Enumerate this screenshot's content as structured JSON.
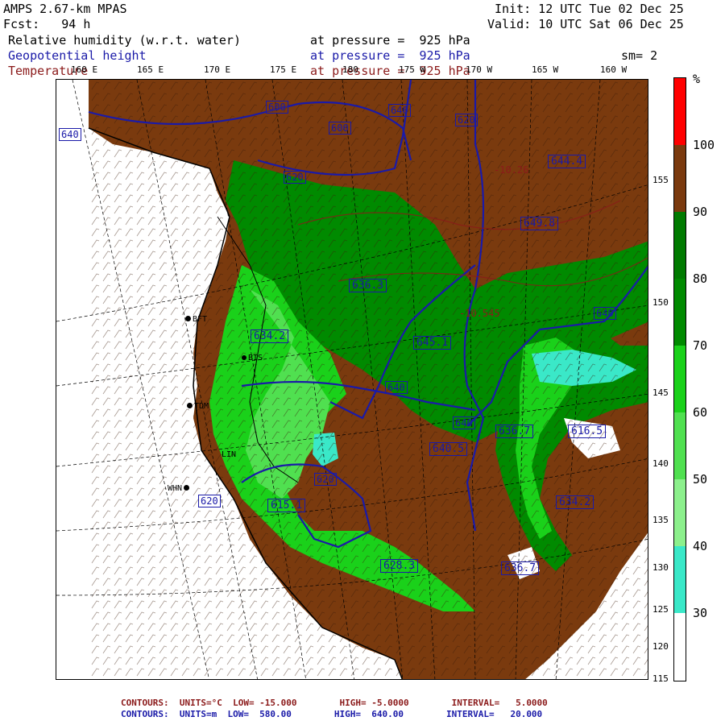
{
  "header": {
    "model": "AMPS 2.67-km MPAS",
    "init": "Init: 12 UTC Tue 02 Dec 25",
    "forecast": "Fcst:   94 h",
    "valid": "Valid: 10 UTC Sat 06 Dec 25",
    "field1": "Relative humidity (w.r.t. water)",
    "field1_level": "at pressure =  925 hPa",
    "field2": "Geopotential height",
    "field2_level": "at pressure =  925 hPa",
    "field3": "Temperature",
    "field3_level": "at pressure =  925 hPa",
    "smooth": "sm= 2"
  },
  "lon_labels": [
    "160 E",
    "165 E",
    "170 E",
    "175 E",
    "180",
    "175 W",
    "170 W",
    "165 W",
    "160 W"
  ],
  "lat_labels": [
    "155",
    "150",
    "145",
    "140",
    "135",
    "130",
    "125",
    "120",
    "115"
  ],
  "colorbar": {
    "unit": "%",
    "labels": [
      "100",
      "90",
      "80",
      "70",
      "60",
      "50",
      "40",
      "30"
    ],
    "colors": {
      "above_100": "#ff0000",
      "r90_100": "#7a3a0e",
      "r80_90": "#007a00",
      "r70_80": "#008a00",
      "r60_70": "#1ad11a",
      "r50_60": "#50e050",
      "r40_50": "#8cf08c",
      "r30_40": "#3ae8c8",
      "below_30": "#ffffff"
    }
  },
  "stations": [
    "BFT",
    "TDM",
    "WHN",
    "LIN",
    "BIS"
  ],
  "height_labels": [
    "600",
    "600",
    "620",
    "640",
    "620",
    "640",
    "640",
    "620",
    "640",
    "640",
    "620"
  ],
  "highs": [
    "644.4",
    "649.8",
    "636.3",
    "645.1",
    "634.2",
    "640.5",
    "636.7",
    "634.2",
    "615.1",
    "628.3",
    "636.7",
    "616.5"
  ],
  "temp_labels": [
    "-10.26",
    "-10.545"
  ],
  "footer": {
    "temp_contours": "CONTOURS:  UNITS=°C  LOW= -15.000        HIGH= -5.0000        INTERVAL=   5.0000",
    "hgt_contours": "CONTOURS:  UNITS=m  LOW=  580.00        HIGH=  640.00        INTERVAL=   20.000"
  }
}
